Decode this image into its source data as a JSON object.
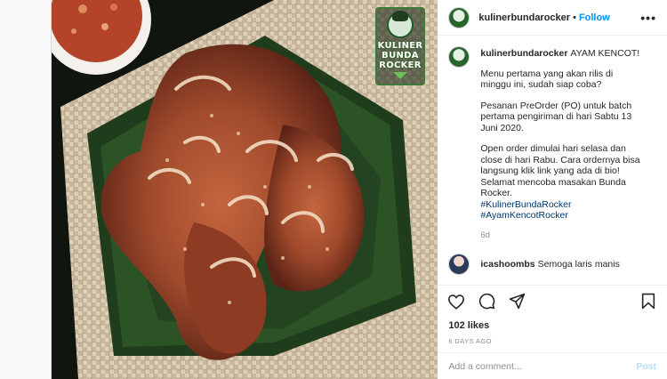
{
  "brand_badge": {
    "line1": "KULINER",
    "line2": "BUNDA",
    "line3": "ROCKER"
  },
  "header": {
    "username": "kulinerbundarocker",
    "separator": "•",
    "follow_label": "Follow",
    "more_label": "•••"
  },
  "caption": {
    "username": "kulinerbundarocker",
    "lead": "AYAM KENCOT!",
    "paragraphs": [
      "Menu pertama yang akan rilis di minggu ini, sudah siap coba?",
      "Pesanan PreOrder (PO) untuk batch pertama pengiriman di hari Sabtu 13 Juni 2020.",
      "Open order dimulai hari selasa dan close di hari Rabu. Cara ordernya bisa langsung klik link yang ada di bio! Selamat mencoba masakan Bunda Rocker."
    ],
    "hashtags": [
      "#KulinerBundaRocker",
      "#AyamKencotRocker"
    ],
    "age": "6d"
  },
  "next_comment": {
    "username": "icashoombs",
    "text": "Semoga laris manis"
  },
  "likes": "102 likes",
  "posted_ago": "6 DAYS AGO",
  "comment_box": {
    "placeholder": "Add a comment...",
    "post_label": "Post"
  },
  "colors": {
    "accent": "#0095f6",
    "badge_green": "#3a7a3a",
    "hashtag": "#00376b"
  },
  "icons": [
    "heart-icon",
    "comment-icon",
    "share-icon",
    "bookmark-icon",
    "more-icon"
  ]
}
